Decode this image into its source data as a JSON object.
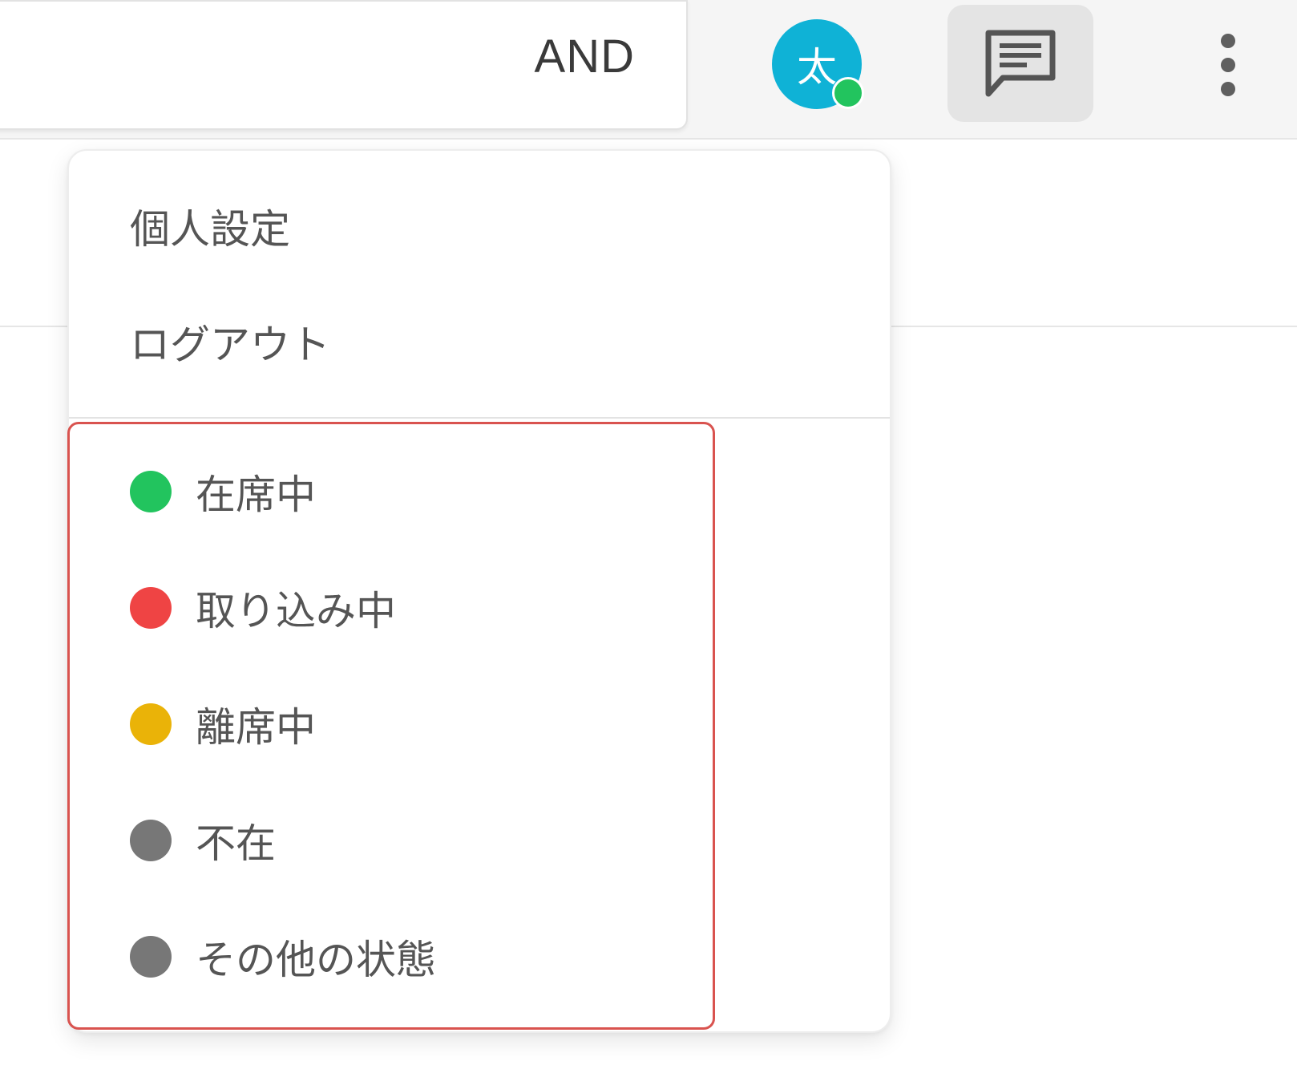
{
  "header": {
    "search_mode": "AND",
    "avatar_initial": "太",
    "avatar_color": "#0fb2d6",
    "avatar_status_color": "#22c45e",
    "chat_icon": "chat-icon",
    "more_icon": "more-vert-icon"
  },
  "menu": {
    "items": [
      {
        "label": "個人設定"
      },
      {
        "label": "ログアウト"
      }
    ],
    "statuses": [
      {
        "label": "在席中",
        "color": "#22c45e"
      },
      {
        "label": "取り込み中",
        "color": "#ef4444"
      },
      {
        "label": "離席中",
        "color": "#eab308"
      },
      {
        "label": "不在",
        "color": "#777777"
      },
      {
        "label": "その他の状態",
        "color": "#777777"
      }
    ],
    "highlight_color": "#d9534f"
  }
}
